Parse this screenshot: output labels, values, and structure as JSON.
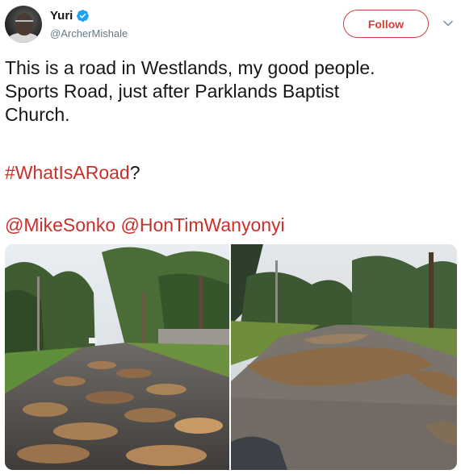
{
  "user": {
    "display_name": "Yuri",
    "handle": "@ArcherMishale",
    "verified": true
  },
  "actions": {
    "follow_label": "Follow"
  },
  "tweet": {
    "text_line1": "This is a road in Westlands, my good people.",
    "text_line2": "Sports Road, just after Parklands Baptist",
    "text_line3": "Church.",
    "hashtag": "#WhatIsARoad",
    "hashtag_suffix": "?",
    "mention1": "@MikeSonko",
    "mention2": "@HonTimWanyonyi"
  },
  "media": {
    "photo_count": 2,
    "left_photo": "potholed-road-trees",
    "right_photo": "flooded-potholed-road"
  },
  "icons": {
    "verified": "verified-badge-icon",
    "menu": "chevron-down-icon"
  },
  "colors": {
    "accent": "#c8302b",
    "verified": "#1da1f2",
    "secondary_text": "#657786"
  }
}
